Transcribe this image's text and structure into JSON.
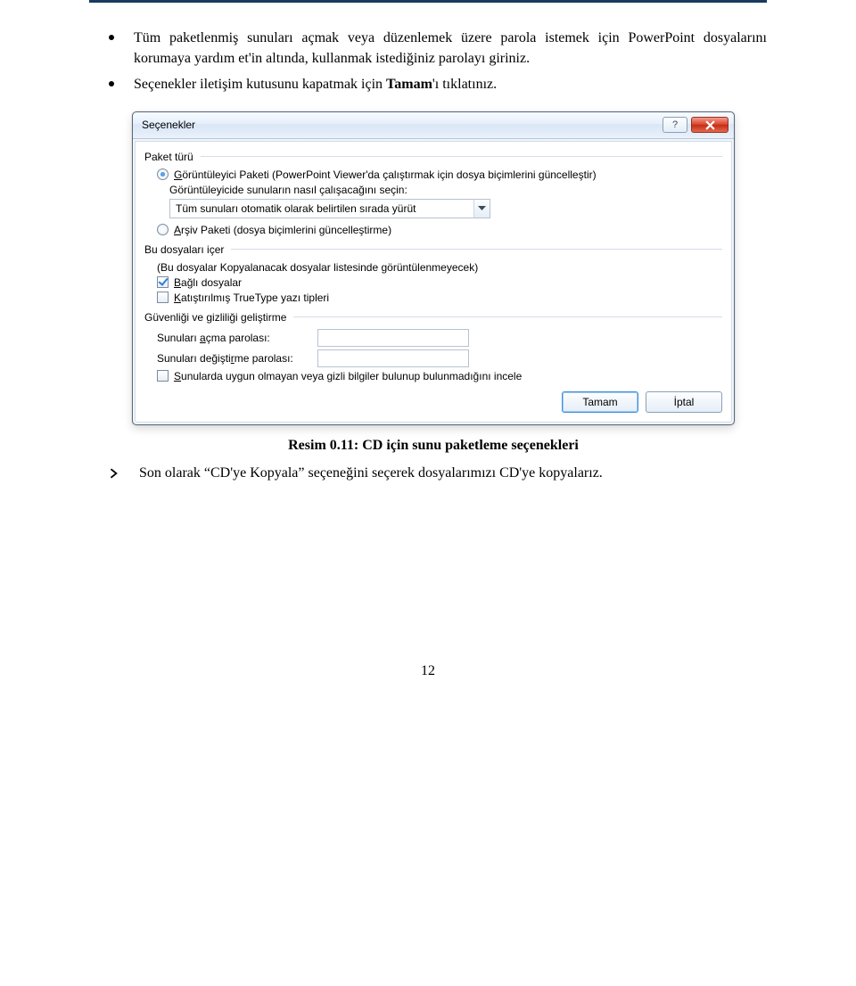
{
  "doc": {
    "bullets": [
      "Tüm paketlenmiş sunuları açmak veya düzenlemek üzere parola istemek için PowerPoint dosyalarını korumaya yardım et'in altında, kullanmak istediğiniz parolayı giriniz.",
      "Seçenekler iletişim kutusunu kapatmak için Tamam'ı tıklatınız."
    ],
    "bold_in_b2": "Tamam",
    "caption": "Resim 0.11: CD için sunu paketleme seçenekleri",
    "final_pre": "Son olarak ",
    "final_quote": "“CD'ye Kopyala”",
    "final_post": " seçeneğini seçerek dosyalarımızı CD'ye kopyalarız.",
    "pagenum": "12"
  },
  "dialog": {
    "title": "Seçenekler",
    "group1": {
      "label": "Paket türü",
      "radio1_pre": "G",
      "radio1_mid": "örüntüleyici Paketi (PowerPoint Viewer'da çalıştırmak için dosya biçimlerini güncelleştir)",
      "sub": "Görüntüleyicide sunuların nasıl çalışacağını seçin:",
      "combo": "Tüm sunuları otomatik olarak belirtilen sırada yürüt",
      "radio2_pre": "A",
      "radio2_mid": "rşiv Paketi (dosya biçimlerini güncelleştirme)"
    },
    "group2": {
      "label": "Bu dosyaları içer",
      "note": "(Bu dosyalar Kopyalanacak dosyalar listesinde görüntülenmeyecek)",
      "chk1_pre": "B",
      "chk1_mid": "ağlı dosyalar",
      "chk2_pre": "K",
      "chk2_mid": "atıştırılmış TrueType yazı tipleri"
    },
    "group3": {
      "label": "Güvenliği ve gizliliği geliştirme",
      "pw1_pre": "Sunuları ",
      "pw1_u": "a",
      "pw1_post": "çma parolası:",
      "pw2_pre": "Sunuları değişti",
      "pw2_u": "r",
      "pw2_mid": "m",
      "pw2_post": "e parolası:",
      "chk_pre": "S",
      "chk_post": "unularda uygun olmayan veya gizli bilgiler bulunup bulunmadığını incele"
    },
    "buttons": {
      "ok": "Tamam",
      "cancel": "İptal"
    }
  }
}
